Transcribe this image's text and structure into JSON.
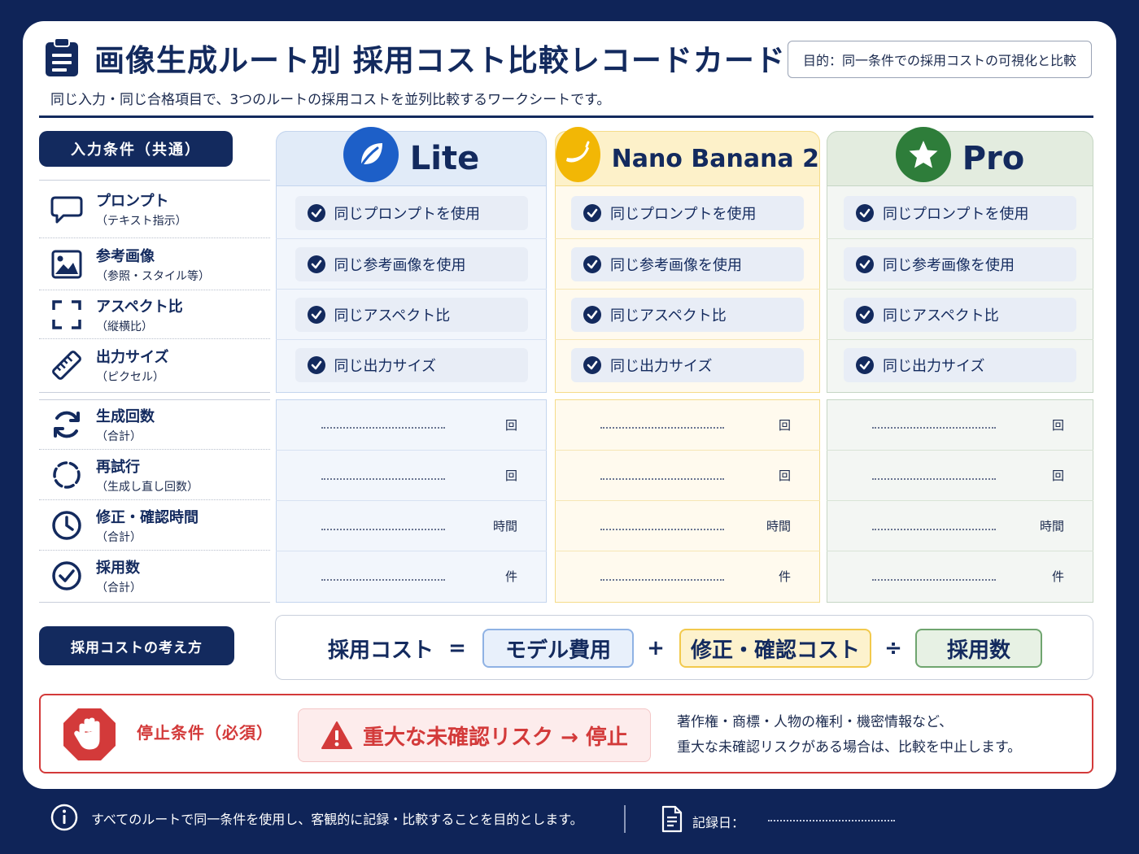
{
  "header": {
    "title": "画像生成ルート別 採用コスト比較レコードカード",
    "purpose": "目的：同一条件での採用コストの可視化と比較",
    "subtitle": "同じ入力・同じ合格項目で、3つのルートの採用コストを並列比較するワークシートです。"
  },
  "input_section": {
    "label": "入力条件（共通）",
    "rows": [
      {
        "title": "プロンプト",
        "sub": "（テキスト指示）",
        "icon": "speech-bubble-icon"
      },
      {
        "title": "参考画像",
        "sub": "（参照・スタイル等）",
        "icon": "image-icon"
      },
      {
        "title": "アスペクト比",
        "sub": "（縦横比）",
        "icon": "aspect-frame-icon"
      },
      {
        "title": "出力サイズ",
        "sub": "（ピクセル）",
        "icon": "ruler-icon"
      }
    ]
  },
  "metric_section": {
    "rows": [
      {
        "title": "生成回数",
        "sub": "（合計）",
        "icon": "refresh-icon",
        "unit": "回"
      },
      {
        "title": "再試行",
        "sub": "（生成し直し回数）",
        "icon": "retry-circle-icon",
        "unit": "回"
      },
      {
        "title": "修正・確認時間",
        "sub": "（合計）",
        "icon": "clock-icon",
        "unit": "時間"
      },
      {
        "title": "採用数",
        "sub": "（合計）",
        "icon": "check-circle-icon",
        "unit": "件"
      }
    ]
  },
  "routes": [
    {
      "name": "Lite",
      "icon": "leaf-icon",
      "accent": "#1d5fc8",
      "bg": "#f2f6fc",
      "head_bg": "#e1ebf8",
      "border": "#c4d5ee",
      "checks": [
        "同じプロンプトを使用",
        "同じ参考画像を使用",
        "同じアスペクト比",
        "同じ出力サイズ"
      ]
    },
    {
      "name": "Nano Banana 2",
      "icon": "banana-icon",
      "accent": "#f2b705",
      "bg": "#fffaee",
      "head_bg": "#fdf1c9",
      "border": "#f5dc8a",
      "checks": [
        "同じプロンプトを使用",
        "同じ参考画像を使用",
        "同じアスペクト比",
        "同じ出力サイズ"
      ]
    },
    {
      "name": "Pro",
      "icon": "star-icon",
      "accent": "#2e7d3a",
      "bg": "#f3f6f3",
      "head_bg": "#e3ecdf",
      "border": "#c6d6c4",
      "checks": [
        "同じプロンプトを使用",
        "同じ参考画像を使用",
        "同じアスペクト比",
        "同じ出力サイズ"
      ]
    }
  ],
  "cost_section": {
    "label": "採用コストの考え方",
    "formula": {
      "lhs": "採用コスト",
      "eq": "=",
      "term1": "モデル費用",
      "plus": "+",
      "term2": "修正・確認コスト",
      "div": "÷",
      "term3": "採用数"
    }
  },
  "stop": {
    "label": "停止条件（必須）",
    "alert": "重大な未確認リスク → 停止",
    "note_line1": "著作権・商標・人物の権利・機密情報など、",
    "note_line2": "重大な未確認リスクがある場合は、比較を中止します。",
    "color": "#d33a3a"
  },
  "footer": {
    "note": "すべてのルートで同一条件を使用し、客観的に記録・比較することを目的とします。",
    "date_label": "記録日："
  }
}
